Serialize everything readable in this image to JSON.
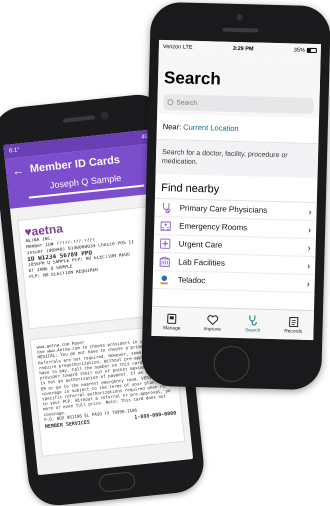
{
  "back_phone": {
    "status": {
      "left": "6:1°",
      "right": "4G 5"
    },
    "header": {
      "title": "Member ID Cards",
      "subtitle": "Joseph Q Sample"
    },
    "card_front": {
      "logo": "♥aetna",
      "lines": [
        "AETNA INC.",
        "Member ID# ?????-???-????",
        "Issuer (80840) 9140000034   Choice POS II",
        "ID W1234 56789              PPO",
        "JOSEPH Q SAMPLE             PCP: NO ELECTION REQU",
        "DT JANE Q SAMPLE",
        "PCP: NO ELECTION REQUIRED"
      ]
    },
    "card_back": {
      "lines": [
        "www.aetna.com                             Payer",
        "Use www.Aetna.com to choose providers in your plan.",
        "MEDICAL: You do not have to choose a primary care",
        "Referrals are not required. However, some services",
        "require preauthorization. Without pre-approval, you",
        "have to pay. Call the number on this card. Out of",
        "provider toward their out of pocket maximum. Refer",
        "is not an authorization of payment. If an emergency",
        "ER or go to the nearest emergency room. VERIFY You",
        "coverage is subject to the terms of your plan.",
        "specific referral authorizations required when ref",
        "to your PCP. Without a referral or pre-approval, yo",
        "more or even full price. Note: This card does not",
        "coverage.",
        "",
        "P.O. BOX 981106        EL PASO         TX 79998-1106"
      ],
      "member_services": "MEMBER SERVICES",
      "phone": "1-888-000-0000"
    }
  },
  "front_phone": {
    "status": {
      "carrier": "Verizon LTE",
      "time": "3:29 PM",
      "battery": "35%"
    },
    "title": "Search",
    "search_placeholder": "Search",
    "near": {
      "label": "Near:",
      "location": "Current Location"
    },
    "hint": "Search for a doctor, facility, procedure or medication.",
    "find_nearby_title": "Find nearby",
    "nearby_items": [
      {
        "label": "Primary Care Physicians",
        "icon": "stethoscope-icon"
      },
      {
        "label": "Emergency Rooms",
        "icon": "hospital-building-icon"
      },
      {
        "label": "Urgent Care",
        "icon": "urgent-care-icon"
      },
      {
        "label": "Lab Facilities",
        "icon": "lab-building-icon"
      },
      {
        "label": "Teladoc",
        "icon": "teladoc-icon"
      }
    ],
    "tabs": [
      {
        "label": "Manage",
        "icon": "id-card-icon",
        "active": false
      },
      {
        "label": "Improve",
        "icon": "heart-icon",
        "active": false
      },
      {
        "label": "Search",
        "icon": "stethoscope-search-icon",
        "active": true
      },
      {
        "label": "Records",
        "icon": "records-icon",
        "active": false
      }
    ],
    "accent_color": "#0f6e7f"
  }
}
